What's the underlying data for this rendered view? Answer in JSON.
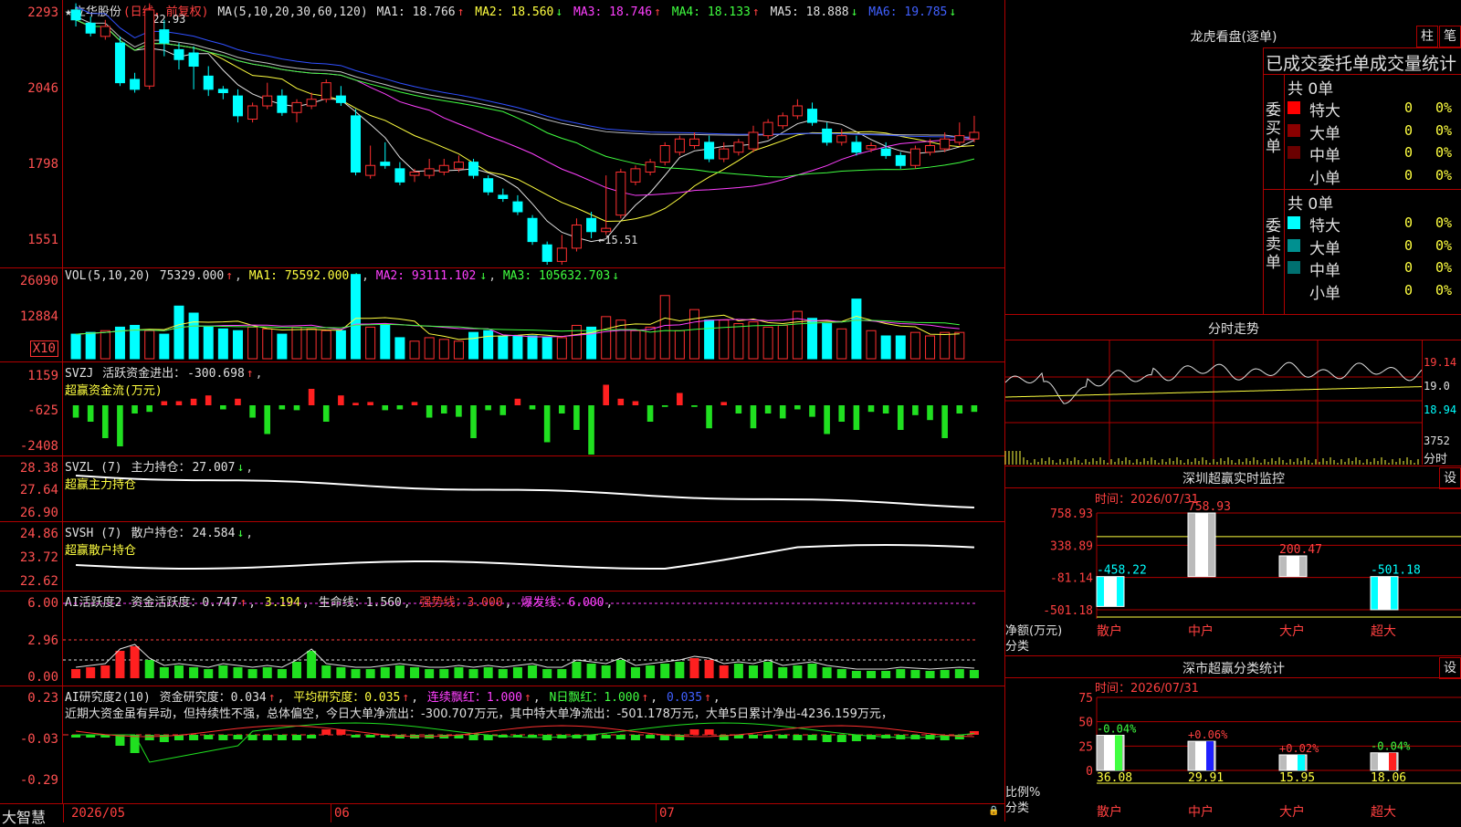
{
  "stock": {
    "name": "立华股份",
    "mode": "(日线，前复权)",
    "star": "★"
  },
  "kline": {
    "ma_label": "MA(5,10,20,30,60,120)",
    "ma": [
      {
        "n": "MA1",
        "v": "18.766",
        "arrow": "↑",
        "color": "#e0e0e0"
      },
      {
        "n": "MA2",
        "v": "18.560",
        "arrow": "↓",
        "color": "#ffff40"
      },
      {
        "n": "MA3",
        "v": "18.746",
        "arrow": "↑",
        "color": "#ff40ff"
      },
      {
        "n": "MA4",
        "v": "18.133",
        "arrow": "↑",
        "color": "#40ff40"
      },
      {
        "n": "MA5",
        "v": "18.888",
        "arrow": "↓",
        "color": "#e0e0e0"
      },
      {
        "n": "MA6",
        "v": "19.785",
        "arrow": "↓",
        "color": "#4060ff"
      }
    ],
    "yticks": [
      "22.93",
      "20.46",
      "17.98",
      "15.51"
    ],
    "high_mark": "←22.93",
    "low_mark": "←15.51",
    "candles": [
      {
        "o": 2280,
        "c": 2250,
        "h": 2300,
        "l": 2230
      },
      {
        "o": 2240,
        "c": 2210,
        "h": 2260,
        "l": 2200
      },
      {
        "o": 2200,
        "c": 2230,
        "h": 2250,
        "l": 2190
      },
      {
        "o": 2180,
        "c": 2060,
        "h": 2200,
        "l": 2050
      },
      {
        "o": 2070,
        "c": 2040,
        "h": 2090,
        "l": 2030
      },
      {
        "o": 2050,
        "c": 2280,
        "h": 2300,
        "l": 2040
      },
      {
        "o": 2220,
        "c": 2180,
        "h": 2250,
        "l": 2140
      },
      {
        "o": 2160,
        "c": 2130,
        "h": 2180,
        "l": 2100
      },
      {
        "o": 2150,
        "c": 2110,
        "h": 2170,
        "l": 2040
      },
      {
        "o": 2080,
        "c": 2040,
        "h": 2110,
        "l": 2020
      },
      {
        "o": 2040,
        "c": 2030,
        "h": 2050,
        "l": 2010
      },
      {
        "o": 2020,
        "c": 1960,
        "h": 2040,
        "l": 1940
      },
      {
        "o": 1950,
        "c": 1990,
        "h": 2000,
        "l": 1940
      },
      {
        "o": 1990,
        "c": 2020,
        "h": 2060,
        "l": 1980
      },
      {
        "o": 2020,
        "c": 1970,
        "h": 2040,
        "l": 1960
      },
      {
        "o": 1970,
        "c": 2000,
        "h": 2010,
        "l": 1940
      },
      {
        "o": 1990,
        "c": 2010,
        "h": 2030,
        "l": 1980
      },
      {
        "o": 2010,
        "c": 2060,
        "h": 2070,
        "l": 2000
      },
      {
        "o": 2020,
        "c": 2000,
        "h": 2050,
        "l": 1990
      },
      {
        "o": 1960,
        "c": 1790,
        "h": 1980,
        "l": 1780
      },
      {
        "o": 1780,
        "c": 1810,
        "h": 1870,
        "l": 1770
      },
      {
        "o": 1820,
        "c": 1810,
        "h": 1880,
        "l": 1800
      },
      {
        "o": 1800,
        "c": 1760,
        "h": 1820,
        "l": 1750
      },
      {
        "o": 1780,
        "c": 1790,
        "h": 1800,
        "l": 1760
      },
      {
        "o": 1780,
        "c": 1800,
        "h": 1830,
        "l": 1770
      },
      {
        "o": 1790,
        "c": 1810,
        "h": 1830,
        "l": 1780
      },
      {
        "o": 1800,
        "c": 1820,
        "h": 1840,
        "l": 1790
      },
      {
        "o": 1820,
        "c": 1780,
        "h": 1830,
        "l": 1770
      },
      {
        "o": 1770,
        "c": 1730,
        "h": 1780,
        "l": 1720
      },
      {
        "o": 1720,
        "c": 1710,
        "h": 1740,
        "l": 1700
      },
      {
        "o": 1700,
        "c": 1670,
        "h": 1720,
        "l": 1660
      },
      {
        "o": 1650,
        "c": 1580,
        "h": 1660,
        "l": 1570
      },
      {
        "o": 1570,
        "c": 1520,
        "h": 1580,
        "l": 1510
      },
      {
        "o": 1520,
        "c": 1560,
        "h": 1600,
        "l": 1510
      },
      {
        "o": 1560,
        "c": 1630,
        "h": 1650,
        "l": 1550
      },
      {
        "o": 1650,
        "c": 1610,
        "h": 1670,
        "l": 1590
      },
      {
        "o": 1610,
        "c": 1620,
        "h": 1780,
        "l": 1600
      },
      {
        "o": 1660,
        "c": 1790,
        "h": 1800,
        "l": 1650
      },
      {
        "o": 1760,
        "c": 1800,
        "h": 1810,
        "l": 1750
      },
      {
        "o": 1790,
        "c": 1820,
        "h": 1830,
        "l": 1780
      },
      {
        "o": 1820,
        "c": 1870,
        "h": 1880,
        "l": 1810
      },
      {
        "o": 1850,
        "c": 1890,
        "h": 1900,
        "l": 1840
      },
      {
        "o": 1870,
        "c": 1890,
        "h": 1910,
        "l": 1860
      },
      {
        "o": 1880,
        "c": 1830,
        "h": 1900,
        "l": 1820
      },
      {
        "o": 1830,
        "c": 1860,
        "h": 1880,
        "l": 1820
      },
      {
        "o": 1850,
        "c": 1880,
        "h": 1890,
        "l": 1840
      },
      {
        "o": 1860,
        "c": 1910,
        "h": 1930,
        "l": 1850
      },
      {
        "o": 1900,
        "c": 1940,
        "h": 1950,
        "l": 1890
      },
      {
        "o": 1930,
        "c": 1960,
        "h": 1970,
        "l": 1920
      },
      {
        "o": 1960,
        "c": 1990,
        "h": 2010,
        "l": 1950
      },
      {
        "o": 1980,
        "c": 1940,
        "h": 2000,
        "l": 1930
      },
      {
        "o": 1920,
        "c": 1880,
        "h": 1940,
        "l": 1870
      },
      {
        "o": 1880,
        "c": 1900,
        "h": 1920,
        "l": 1870
      },
      {
        "o": 1880,
        "c": 1850,
        "h": 1900,
        "l": 1840
      },
      {
        "o": 1860,
        "c": 1870,
        "h": 1880,
        "l": 1850
      },
      {
        "o": 1860,
        "c": 1840,
        "h": 1880,
        "l": 1830
      },
      {
        "o": 1840,
        "c": 1810,
        "h": 1850,
        "l": 1800
      },
      {
        "o": 1810,
        "c": 1860,
        "h": 1870,
        "l": 1800
      },
      {
        "o": 1850,
        "c": 1870,
        "h": 1890,
        "l": 1840
      },
      {
        "o": 1860,
        "c": 1890,
        "h": 1910,
        "l": 1850
      },
      {
        "o": 1880,
        "c": 1900,
        "h": 1940,
        "l": 1870
      },
      {
        "o": 1890,
        "c": 1910,
        "h": 1960,
        "l": 1880
      }
    ]
  },
  "vol": {
    "label": "VOL(5,10,20)",
    "value": "75329.000",
    "ma": [
      {
        "n": "MA1",
        "v": "75592.000"
      },
      {
        "n": "MA2",
        "v": "93111.102"
      },
      {
        "n": "MA3",
        "v": "105632.703"
      }
    ],
    "yticks": [
      "26090",
      "12884"
    ],
    "unit": "X10",
    "bars": [
      14,
      15,
      16,
      18,
      19,
      16,
      14,
      30,
      26,
      18,
      17,
      16,
      18,
      17,
      14,
      18,
      17,
      16,
      16,
      48,
      18,
      19,
      12,
      10,
      12,
      11,
      10,
      15,
      16,
      13,
      13,
      13,
      12,
      12,
      19,
      18,
      24,
      22,
      16,
      18,
      36,
      16,
      28,
      22,
      22,
      20,
      21,
      18,
      19,
      27,
      23,
      20,
      17,
      34,
      16,
      13,
      13,
      15,
      13,
      15,
      15
    ]
  },
  "svzj": {
    "label": "SVZJ",
    "title": "活跃资金进出：",
    "value": "-300.698",
    "sub": "超赢资金流(万元)",
    "yticks": [
      "1159",
      "-625",
      "-2408"
    ],
    "bars": [
      -15,
      -20,
      -40,
      -50,
      -10,
      -8,
      5,
      5,
      8,
      12,
      -5,
      8,
      -15,
      -35,
      -5,
      -6,
      20,
      -20,
      12,
      3,
      4,
      -6,
      -5,
      4,
      -15,
      -10,
      -14,
      -40,
      -6,
      -12,
      8,
      -5,
      -45,
      -10,
      -30,
      -60,
      25,
      8,
      5,
      -20,
      -2,
      15,
      -2,
      -28,
      4,
      -10,
      -28,
      -10,
      -16,
      -5,
      -14,
      -35,
      -20,
      -30,
      -8,
      -10,
      -30,
      -12,
      -18,
      -40,
      -10,
      -8
    ]
  },
  "svzl": {
    "label": "SVZL  (7)",
    "title": "主力持仓：",
    "value": "27.007",
    "sub": "超赢主力持仓",
    "yticks": [
      "28.38",
      "27.64",
      "26.90"
    ]
  },
  "svsh": {
    "label": "SVSH  (7)",
    "title": "散户持仓：",
    "value": "24.584",
    "sub": "超赢散户持仓",
    "yticks": [
      "24.86",
      "23.72",
      "22.62"
    ]
  },
  "ai1": {
    "label": "AI活跃度2",
    "items": [
      {
        "t": "资金活跃度：",
        "v": "0.747",
        "a": "↑",
        "c": "#e0e0e0"
      },
      {
        "t": "",
        "v": "3.194",
        "a": "",
        "c": "#ffff40"
      },
      {
        "t": "生命线：",
        "v": "1.560",
        "a": "",
        "c": "#e0e0e0"
      },
      {
        "t": "强势线：",
        "v": "3.000",
        "a": "",
        "c": "#ff4040"
      },
      {
        "t": "爆发线：",
        "v": "6.000",
        "a": "",
        "c": "#ff40ff"
      }
    ],
    "yticks": [
      "6.00",
      "2.96",
      "0.00"
    ],
    "bars": [
      10,
      12,
      14,
      30,
      35,
      20,
      12,
      14,
      12,
      10,
      14,
      12,
      10,
      12,
      10,
      18,
      30,
      14,
      12,
      10,
      10,
      12,
      14,
      12,
      10,
      10,
      12,
      10,
      12,
      10,
      12,
      14,
      10,
      10,
      18,
      16,
      14,
      20,
      12,
      14,
      16,
      18,
      22,
      20,
      14,
      16,
      14,
      18,
      12,
      14,
      16,
      12,
      10,
      8,
      8,
      8,
      10,
      9,
      8,
      9,
      10,
      9
    ]
  },
  "ai2": {
    "label": "AI研究度2(10)",
    "items": [
      {
        "t": "资金研究度：",
        "v": "0.034",
        "a": "↑",
        "c": "#e0e0e0"
      },
      {
        "t": "平均研究度：",
        "v": "0.035",
        "a": "↑",
        "c": "#ffff40"
      },
      {
        "t": "连续飘红：",
        "v": "1.000",
        "a": "↑",
        "c": "#ff40ff"
      },
      {
        "t": "N日飘红：",
        "v": "1.000",
        "a": "↑",
        "c": "#40ff40"
      },
      {
        "t": "",
        "v": "0.035",
        "a": "↑",
        "c": "#4060ff"
      }
    ],
    "comment": "近期大资金虽有异动，但持续性不强，总体偏空，今日大单净流出：-300.707万元，其中特大单净流出：-501.178万元，大单5日累计净出-4236.159万元，",
    "yticks": [
      "0.23",
      "-0.03",
      "-0.29"
    ]
  },
  "bottom": {
    "brand": "大智慧",
    "dates": [
      "2026/05",
      "06",
      "07"
    ]
  },
  "right": {
    "lhb": {
      "title": "龙虎看盘(逐单)",
      "btn1": "柱",
      "btn2": "笔",
      "subtitle": "已成交委托单成交量统计",
      "buy": {
        "label": "委买单",
        "total": "共 0单",
        "rows": [
          {
            "n": "特大",
            "v": "0",
            "p": "0%",
            "c": "#ff0000"
          },
          {
            "n": "大单",
            "v": "0",
            "p": "0%",
            "c": "#8b0000"
          },
          {
            "n": "中单",
            "v": "0",
            "p": "0%",
            "c": "#6b0000"
          },
          {
            "n": "小单",
            "v": "0",
            "p": "0%",
            "c": ""
          }
        ]
      },
      "sell": {
        "label": "委卖单",
        "total": "共 0单",
        "rows": [
          {
            "n": "特大",
            "v": "0",
            "p": "0%",
            "c": "#00ffff"
          },
          {
            "n": "大单",
            "v": "0",
            "p": "0%",
            "c": "#009090"
          },
          {
            "n": "中单",
            "v": "0",
            "p": "0%",
            "c": "#007070"
          },
          {
            "n": "小单",
            "v": "0",
            "p": "0%",
            "c": ""
          }
        ]
      }
    },
    "fenshi": {
      "title": "分时走势",
      "yticks": [
        "19.14",
        "19.0",
        "18.94",
        "3752"
      ],
      "xlabel": "分时"
    },
    "monitor": {
      "title": "深圳超赢实时监控",
      "btn": "设",
      "time": "时间：2026/07/31",
      "yticks": [
        "758.93",
        "338.89",
        "-81.14",
        "-501.18"
      ],
      "ylabel": "净额(万元)",
      "xlabel": "分类",
      "cats": [
        {
          "n": "散户",
          "v": -458.22,
          "label": "-458.22"
        },
        {
          "n": "中户",
          "v": 758.93,
          "label": "758.93"
        },
        {
          "n": "大户",
          "v": 200.47,
          "label": "200.47"
        },
        {
          "n": "超大",
          "v": -501.18,
          "label": "-501.18"
        }
      ]
    },
    "stats": {
      "title": "深市超赢分类统计",
      "btn": "设",
      "time": "时间：2026/07/31",
      "yticks": [
        "75",
        "50",
        "25",
        "0"
      ],
      "ylabel": "比例%",
      "xlabel": "分类",
      "cats": [
        {
          "n": "散户",
          "v": 36.08,
          "label": "36.08",
          "d": "-0.04%",
          "c": "#40ff40"
        },
        {
          "n": "中户",
          "v": 29.91,
          "label": "29.91",
          "d": "+0.06%",
          "c": "#2020ff"
        },
        {
          "n": "大户",
          "v": 15.95,
          "label": "15.95",
          "d": "+0.02%",
          "c": "#00ffff"
        },
        {
          "n": "超大",
          "v": 18.06,
          "label": "18.06",
          "d": "-0.04%",
          "c": "#ff2020"
        }
      ]
    }
  }
}
